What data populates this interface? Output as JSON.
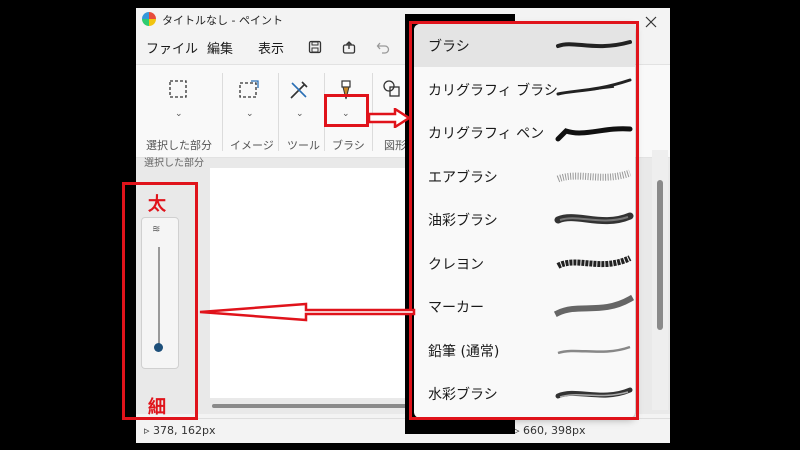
{
  "window": {
    "title": "タイトルなし - ペイント"
  },
  "menu": {
    "file": "ファイル",
    "edit": "編集",
    "view": "表示"
  },
  "ribbon": {
    "select_label": "選択した部分",
    "image_label": "イメージ",
    "tools_label": "ツール",
    "brush_label": "ブラシ",
    "shapes_label": "図形"
  },
  "canvas_label_fragment": "選択した部分",
  "status": {
    "position": "378, 162px",
    "size": "660, 398px"
  },
  "brushes": [
    {
      "label": "ブラシ",
      "selected": true
    },
    {
      "label": "カリグラフィ ブラシ",
      "selected": false
    },
    {
      "label": "カリグラフィ ペン",
      "selected": false
    },
    {
      "label": "エアブラシ",
      "selected": false
    },
    {
      "label": "油彩ブラシ",
      "selected": false
    },
    {
      "label": "クレヨン",
      "selected": false
    },
    {
      "label": "マーカー",
      "selected": false
    },
    {
      "label": "鉛筆 (通常)",
      "selected": false
    },
    {
      "label": "水彩ブラシ",
      "selected": false
    }
  ],
  "annotation": {
    "thick": "太",
    "thin": "細",
    "color": "#e0131b"
  },
  "size_slider": {
    "level": 0.0
  }
}
